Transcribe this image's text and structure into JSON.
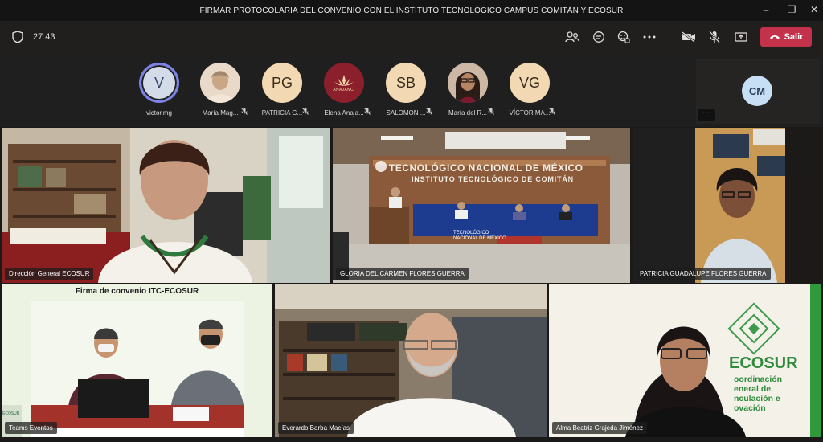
{
  "window": {
    "title": "FIRMAR PROTOCOLARIA DEL CONVENIO CON EL INSTITUTO TECNOLÓGICO CAMPUS COMITÁN Y ECOSUR"
  },
  "toolbar": {
    "timer": "27:43",
    "leave_label": "Salir"
  },
  "participants": [
    {
      "initials": "V",
      "name": "victor.mg"
    },
    {
      "initials": "",
      "name": "María Mag..."
    },
    {
      "initials": "PG",
      "name": "PATRICIA G..."
    },
    {
      "initials": "ANAJANCI",
      "name": "Elena Anaja..."
    },
    {
      "initials": "SB",
      "name": "SALOMON ..."
    },
    {
      "initials": "",
      "name": "María del R..."
    },
    {
      "initials": "VG",
      "name": "VÍCTOR MA..."
    }
  ],
  "side_participant": {
    "initials": "CM",
    "more": "···"
  },
  "tiles": {
    "t1": {
      "name": "Dirección General ECOSUR"
    },
    "t2": {
      "name": "GLORIA DEL CARMEN FLORES GUERRA",
      "banner1": "TECNOLÓGICO NACIONAL DE MÉXICO",
      "banner2": "INSTITUTO TECNOLÓGICO DE COMITÁN",
      "podium1": "TECNOLÓGICO",
      "podium2": "NACIONAL DE MÉXICO"
    },
    "t3": {
      "name": "PATRICIA GUADALUPE FLORES GUERRA"
    },
    "t4": {
      "name": "Teams Eventos",
      "heading": "Firma de convenio ITC-ECOSUR",
      "corner": "ECOSUR"
    },
    "t5": {
      "name": "Everardo Barba Macías"
    },
    "t6": {
      "name": "Alma Beatriz Grajeda Jiménez",
      "brand": "ECOSUR",
      "line1": "oordinación",
      "line2": "eneral de",
      "line3": "nculación e",
      "line4": "ovación"
    }
  }
}
